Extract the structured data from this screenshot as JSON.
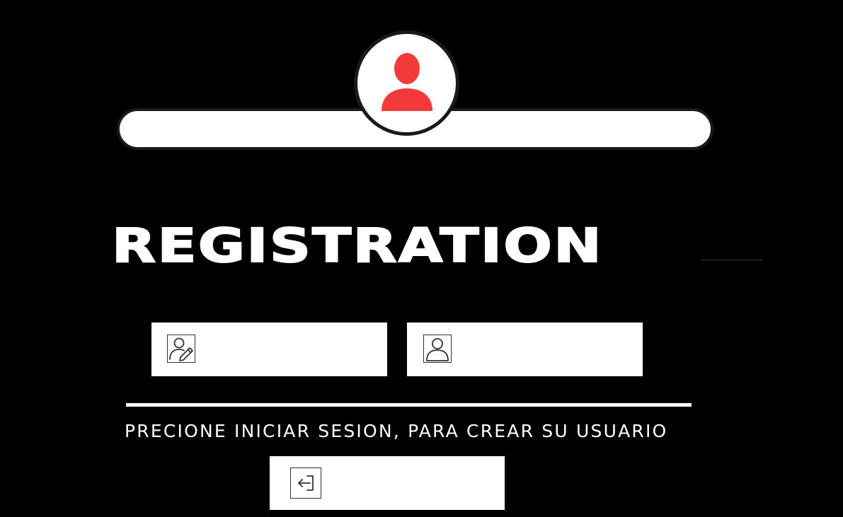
{
  "header": {
    "avatar_icon": "user-icon",
    "bar_text": ""
  },
  "title": "REGISTRATION",
  "form": {
    "username_field": {
      "icon": "user-edit-icon",
      "value": "",
      "placeholder": ""
    },
    "user_field": {
      "icon": "user-icon",
      "value": "",
      "placeholder": ""
    }
  },
  "instruction": "PRECIONE INICIAR SESION, PARA CREAR SU USUARIO",
  "login_button": {
    "icon": "login-icon",
    "label": ""
  },
  "colors": {
    "background": "#000000",
    "surface": "#ffffff",
    "accent": "#f23a3a",
    "icon_stroke": "#333333"
  }
}
